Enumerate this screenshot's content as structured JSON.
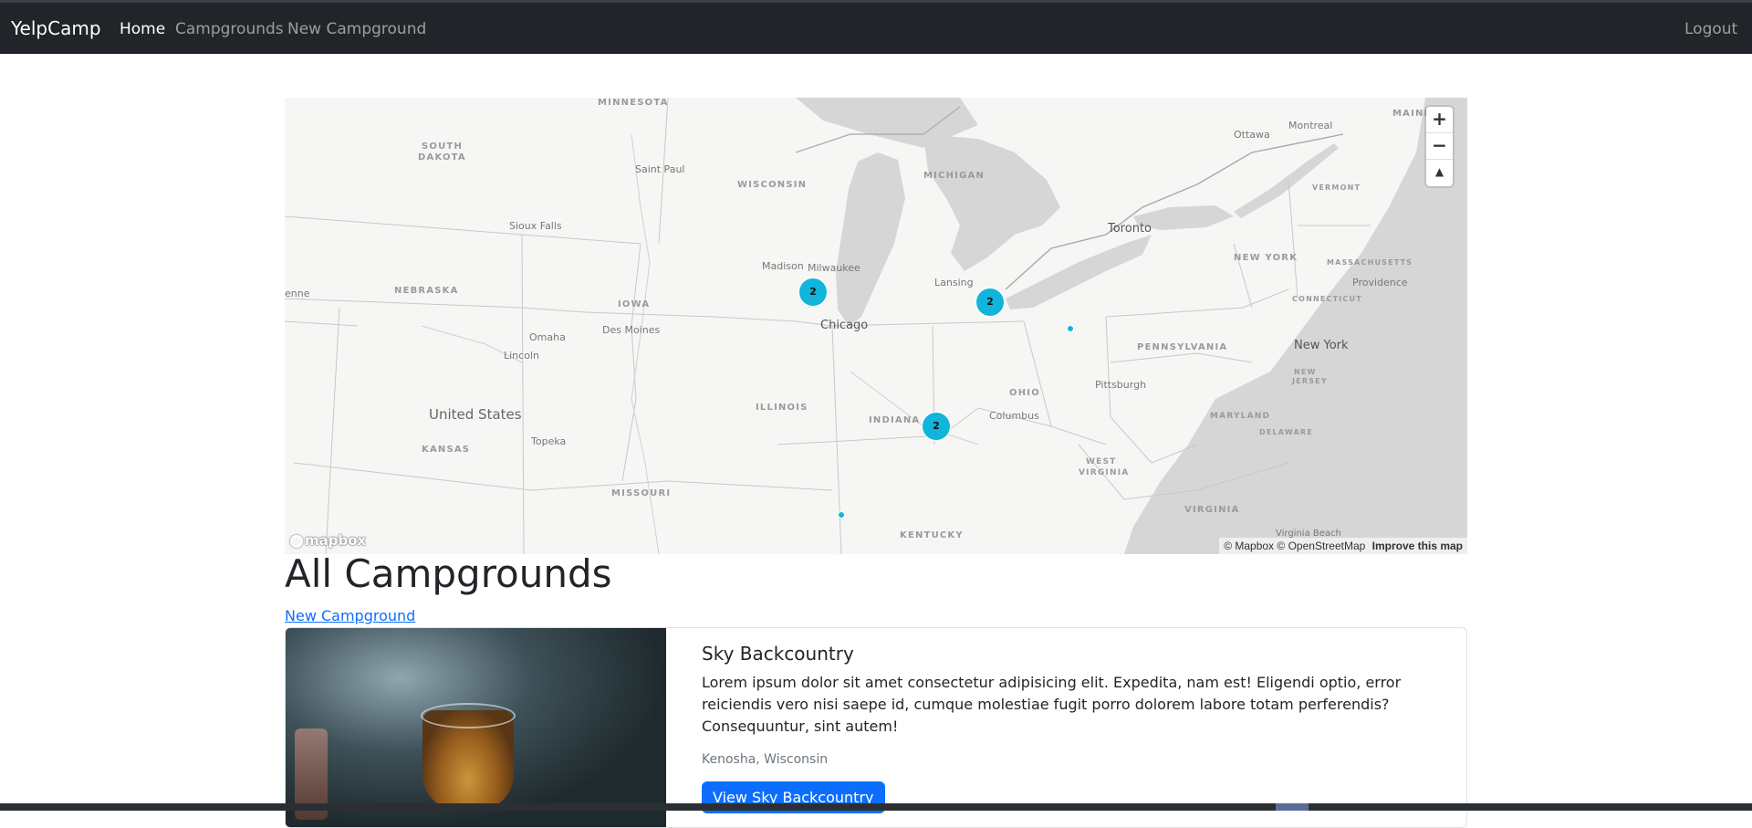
{
  "navbar": {
    "brand": "YelpCamp",
    "links": [
      {
        "label": "Home",
        "active": true
      },
      {
        "label": "Campgrounds",
        "active": false
      },
      {
        "label": "New Campground",
        "active": false
      }
    ],
    "logout": "Logout"
  },
  "map": {
    "labels": {
      "minnesota": "MINNESOTA",
      "south_dakota_1": "SOUTH",
      "south_dakota_2": "DAKOTA",
      "wisconsin": "WISCONSIN",
      "michigan": "MICHIGAN",
      "saint_paul": "Saint Paul",
      "sioux_falls": "Sioux Falls",
      "madison": "Madison",
      "milwaukee": "Milwaukee",
      "lansing": "Lansing",
      "chicago": "Chicago",
      "nebraska": "NEBRASKA",
      "iowa": "IOWA",
      "des_moines": "Des Moines",
      "omaha": "Omaha",
      "lincoln": "Lincoln",
      "illinois": "ILLINOIS",
      "indiana": "INDIANA",
      "ohio": "OHIO",
      "columbus": "Columbus",
      "pittsburgh": "Pittsburgh",
      "pennsylvania": "PENNSYLVANIA",
      "new_york_state": "NEW YORK",
      "new_york_city": "New York",
      "toronto": "Toronto",
      "ottawa": "Ottawa",
      "montreal": "Montreal",
      "maine": "MAINE",
      "vermont": "VERMONT",
      "massachusetts": "MASSACHUSETTS",
      "connecticut": "CONNECTICUT",
      "providence": "Providence",
      "new_jersey_1": "NEW",
      "new_jersey_2": "JERSEY",
      "maryland": "MARYLAND",
      "delaware": "DELAWARE",
      "west_virginia_1": "WEST",
      "west_virginia_2": "VIRGINIA",
      "virginia": "VIRGINIA",
      "virginia_beach": "Virginia Beach",
      "kentucky": "KENTUCKY",
      "missouri": "MISSOURI",
      "kansas": "KANSAS",
      "topeka": "Topeka",
      "united_states": "United States",
      "cheyenne_partial": "enne"
    },
    "clusters": [
      {
        "count": "2",
        "near": "Madison"
      },
      {
        "count": "2",
        "near": "Lansing"
      },
      {
        "count": "2",
        "near": "Indiana"
      }
    ],
    "controls": {
      "zoom_in": "+",
      "zoom_out": "−",
      "compass": "▲"
    },
    "logo": "mapbox",
    "attribution": {
      "mapbox": "© Mapbox",
      "osm": "© OpenStreetMap",
      "improve": "Improve this map"
    },
    "colors": {
      "land": "#f6f6f4",
      "water": "#d6d6d6",
      "marker": "#11b4da"
    }
  },
  "page": {
    "title": "All Campgrounds",
    "new_link": "New Campground"
  },
  "campgrounds": [
    {
      "title": "Sky Backcountry",
      "description": "Lorem ipsum dolor sit amet consectetur adipisicing elit. Expedita, nam est! Eligendi optio, error reiciendis vero nisi saepe id, cumque molestiae fugit porro dolorem labore totam perferendis? Consequuntur, sint autem!",
      "location": "Kenosha, Wisconsin",
      "button": "View Sky Backcountry"
    }
  ]
}
